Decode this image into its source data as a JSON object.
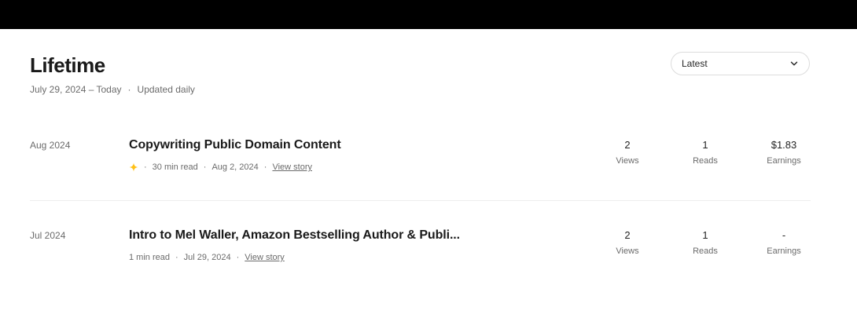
{
  "header": {
    "title": "Lifetime",
    "date_range": "July 29, 2024 – Today",
    "separator": "·",
    "update_note": "Updated daily"
  },
  "sort": {
    "selected": "Latest",
    "icon": "chevron-down-icon"
  },
  "stories": [
    {
      "month": "Aug 2024",
      "title": "Copywriting Public Domain Content",
      "has_boost_icon": true,
      "boost_icon": "sparkle-icon",
      "boost_color": "#ffc017",
      "read_time": "30 min read",
      "date": "Aug 2, 2024",
      "link": "View story",
      "views": "2",
      "views_label": "Views",
      "reads": "1",
      "reads_label": "Reads",
      "earnings": "$1.83",
      "earnings_label": "Earnings"
    },
    {
      "month": "Jul 2024",
      "title": "Intro to Mel Waller, Amazon Bestselling Author & Publi...",
      "has_boost_icon": false,
      "read_time": "1 min read",
      "date": "Jul 29, 2024",
      "link": "View story",
      "views": "2",
      "views_label": "Views",
      "reads": "1",
      "reads_label": "Reads",
      "earnings": "-",
      "earnings_label": "Earnings"
    }
  ]
}
